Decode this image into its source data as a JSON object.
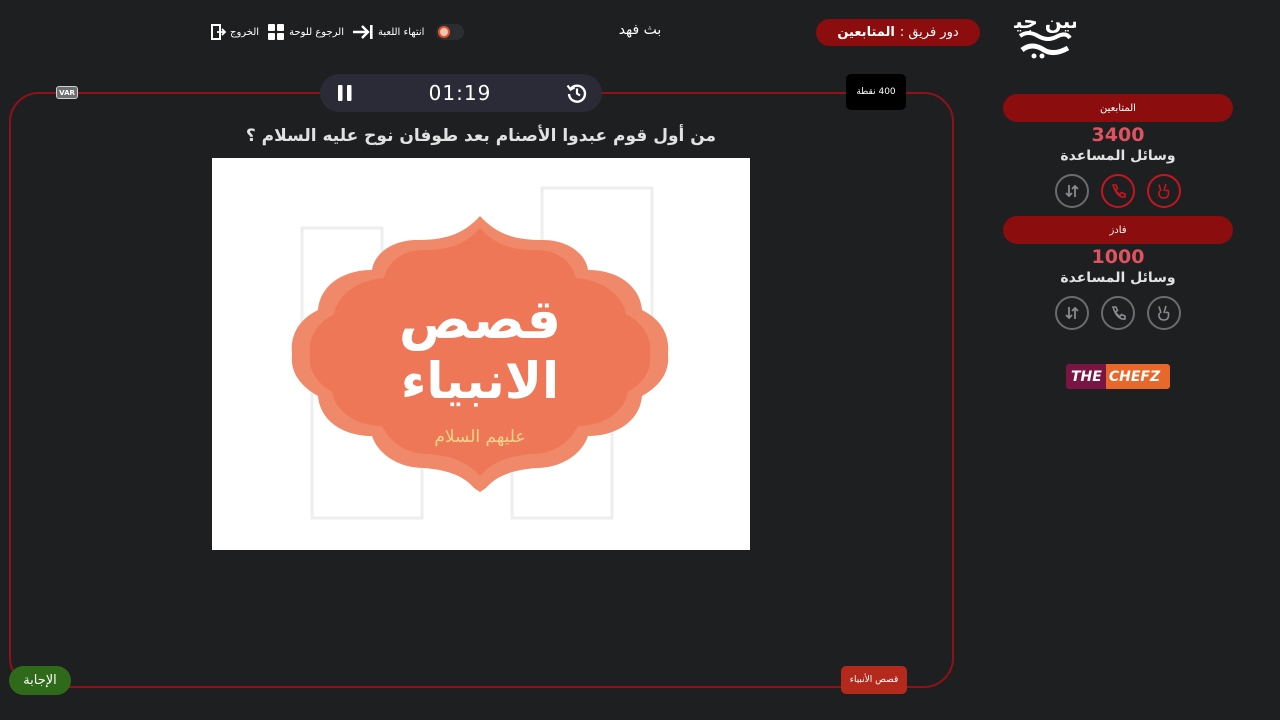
{
  "top": {
    "logo_text": "سين جيم",
    "team_turn_label": "دور فريق :",
    "team_turn_name": "المتابعين",
    "broadcaster": "بث فهد",
    "end_game": "انتهاء اللعبة",
    "back_to_board": "الرجوع للوحة",
    "exit": "الخروج"
  },
  "game": {
    "var_label": "VAR",
    "timer": "01:19",
    "points": "400 نقطة",
    "question": "من أول قوم عبدوا الأصنام بعد طوفان نوح عليه السلام ؟",
    "image_title_line1": "قصص",
    "image_title_line2": "الانبياء",
    "image_subtitle": "عليهم السلام",
    "answer_button": "الإجابة",
    "category": "قصص الأنبياء"
  },
  "teams": [
    {
      "name": "المتابعين",
      "score": "3400",
      "helpers_title": "وسائل المساعدة"
    },
    {
      "name": "فادز",
      "score": "1000",
      "helpers_title": "وسائل المساعدة"
    }
  ],
  "sponsor": {
    "part1": "THE",
    "part2": "CHEFZ"
  },
  "colors": {
    "accent_red": "#8b0d0d",
    "frame_red": "#8e1218",
    "score_pink": "#e0525f",
    "answer_green": "#2f6a1b",
    "background": "#1e1f21"
  }
}
